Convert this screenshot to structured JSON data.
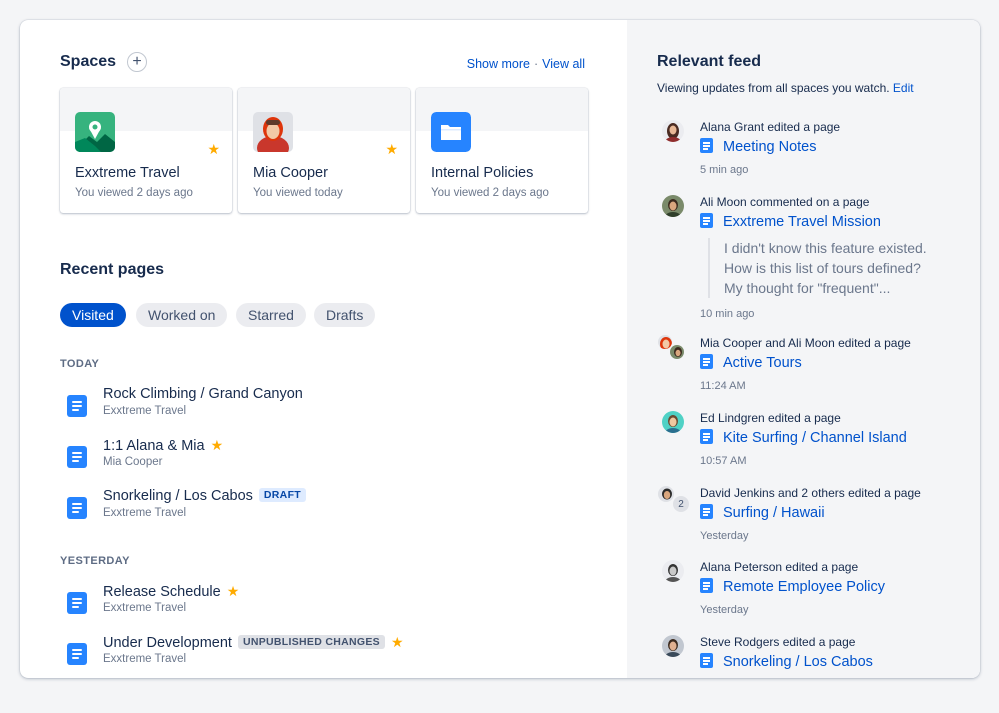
{
  "spaces": {
    "title": "Spaces",
    "add_label": "+",
    "show_more": "Show more",
    "sep": "·",
    "view_all": "View all",
    "cards": [
      {
        "name": "Exxtreme Travel",
        "sub": "You viewed 2 days ago",
        "icon": "travel-space-icon",
        "starred": true
      },
      {
        "name": "Mia Cooper",
        "sub": "You viewed today",
        "icon": "user-avatar",
        "starred": true
      },
      {
        "name": "Internal Policies",
        "sub": "You viewed 2 days ago",
        "icon": "folder-icon",
        "starred": false
      }
    ]
  },
  "recent": {
    "title": "Recent pages",
    "tabs": [
      "Visited",
      "Worked on",
      "Starred",
      "Drafts"
    ],
    "active_tab": "Visited",
    "groups": [
      {
        "label": "TODAY",
        "pages": [
          {
            "title": "Rock Climbing / Grand Canyon",
            "space": "Exxtreme Travel"
          },
          {
            "title": "1:1 Alana & Mia",
            "space": "Mia Cooper",
            "starred": true
          },
          {
            "title": "Snorkeling / Los Cabos",
            "space": "Exxtreme Travel",
            "lozenge": "DRAFT"
          }
        ]
      },
      {
        "label": "YESTERDAY",
        "pages": [
          {
            "title": "Release Schedule",
            "space": "Exxtreme Travel",
            "starred": true
          },
          {
            "title": "Under Development",
            "space": "Exxtreme Travel",
            "lozenge": "UNPUBLISHED CHANGES",
            "starred": true
          }
        ]
      }
    ]
  },
  "feed": {
    "title": "Relevant feed",
    "subtitle": "Viewing updates from all spaces you watch.",
    "edit_label": "Edit",
    "items": [
      {
        "actor": "Alana Grant edited a page",
        "page": "Meeting Notes",
        "time": "5 min ago"
      },
      {
        "actor": "Ali Moon commented on a page",
        "page": "Exxtreme Travel Mission",
        "comment": [
          "I didn't know this feature existed.",
          "How is this list of tours defined?",
          "My thought for \"frequent\"..."
        ],
        "time": "10 min ago"
      },
      {
        "actor": "Mia Cooper and Ali Moon edited a page",
        "page": "Active Tours",
        "time": "11:24 AM"
      },
      {
        "actor": "Ed Lindgren edited a page",
        "page": "Kite Surfing / Channel Island",
        "time": "10:57 AM"
      },
      {
        "actor": "David Jenkins and 2 others edited a page",
        "page": "Surfing / Hawaii",
        "time": "Yesterday",
        "extra_count": "2"
      },
      {
        "actor": "Alana Peterson edited a page",
        "page": "Remote Employee Policy",
        "time": "Yesterday"
      },
      {
        "actor": "Steve Rodgers edited a page",
        "page": "Snorkeling / Los Cabos",
        "time": ""
      }
    ]
  },
  "colors": {
    "accent": "#0052cc",
    "star": "#ffab00",
    "page_icon": "#2684ff"
  }
}
